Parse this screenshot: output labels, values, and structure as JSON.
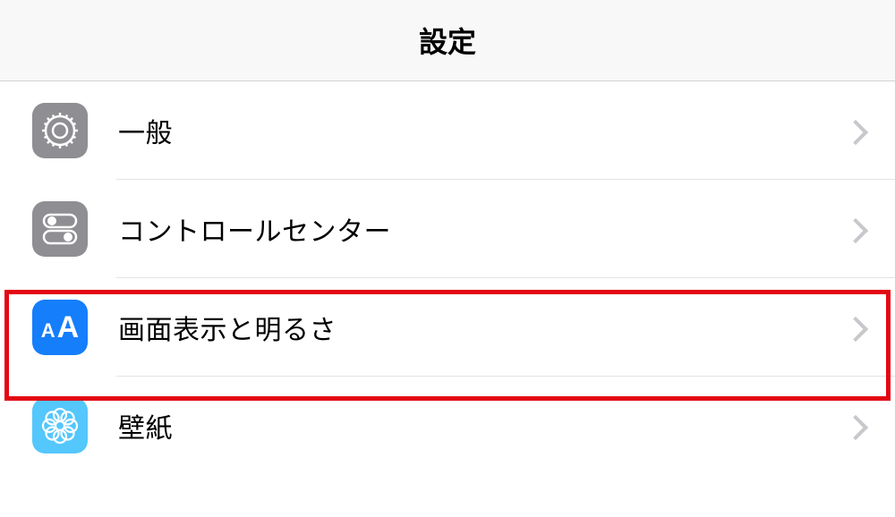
{
  "header": {
    "title": "設定"
  },
  "settings": {
    "items": [
      {
        "label": "一般",
        "icon": "gear"
      },
      {
        "label": "コントロールセンター",
        "icon": "control-center"
      },
      {
        "label": "画面表示と明るさ",
        "icon": "display-brightness",
        "highlighted": true
      },
      {
        "label": "壁紙",
        "icon": "wallpaper"
      }
    ]
  }
}
